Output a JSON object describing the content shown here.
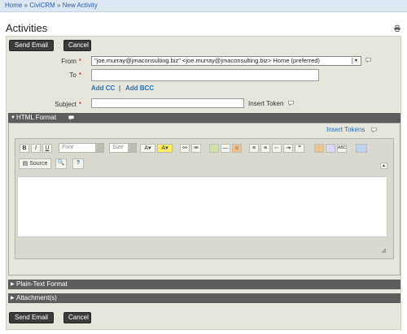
{
  "breadcrumb": {
    "items": [
      "Home",
      "CiviCRM",
      "New Activity"
    ],
    "separator": "»"
  },
  "page": {
    "title": "Activities"
  },
  "buttons": {
    "send_email": "Send Email",
    "cancel": "Cancel"
  },
  "form": {
    "from_label": "From",
    "from_value": "\"joe.murray@jmaconsulting.biz\" <joe.murray@jmaconsulting.biz> Home (preferred)",
    "to_label": "To",
    "to_value": "",
    "add_cc": "Add CC",
    "link_sep": "|",
    "add_bcc": "Add BCC",
    "subject_label": "Subject",
    "subject_value": "",
    "insert_token": "Insert Token",
    "required_marker": "*"
  },
  "sections": {
    "html_format": "HTML Format",
    "insert_tokens": "Insert Tokens",
    "plain_text_format": "Plain-Text Format",
    "attachments": "Attachment(s)"
  },
  "editor": {
    "bold": "B",
    "italic": "I",
    "underline": "U",
    "font_placeholder": "Font",
    "size_placeholder": "Size",
    "source": "Source"
  },
  "colors": {
    "breadcrumb_bg": "#dce7f3",
    "panel_bg": "#e6e6dd",
    "button_bg": "#3b3b3b",
    "section_bar_bg": "#5d5d5d",
    "link": "#2a6fb2",
    "required": "#cc0000"
  }
}
